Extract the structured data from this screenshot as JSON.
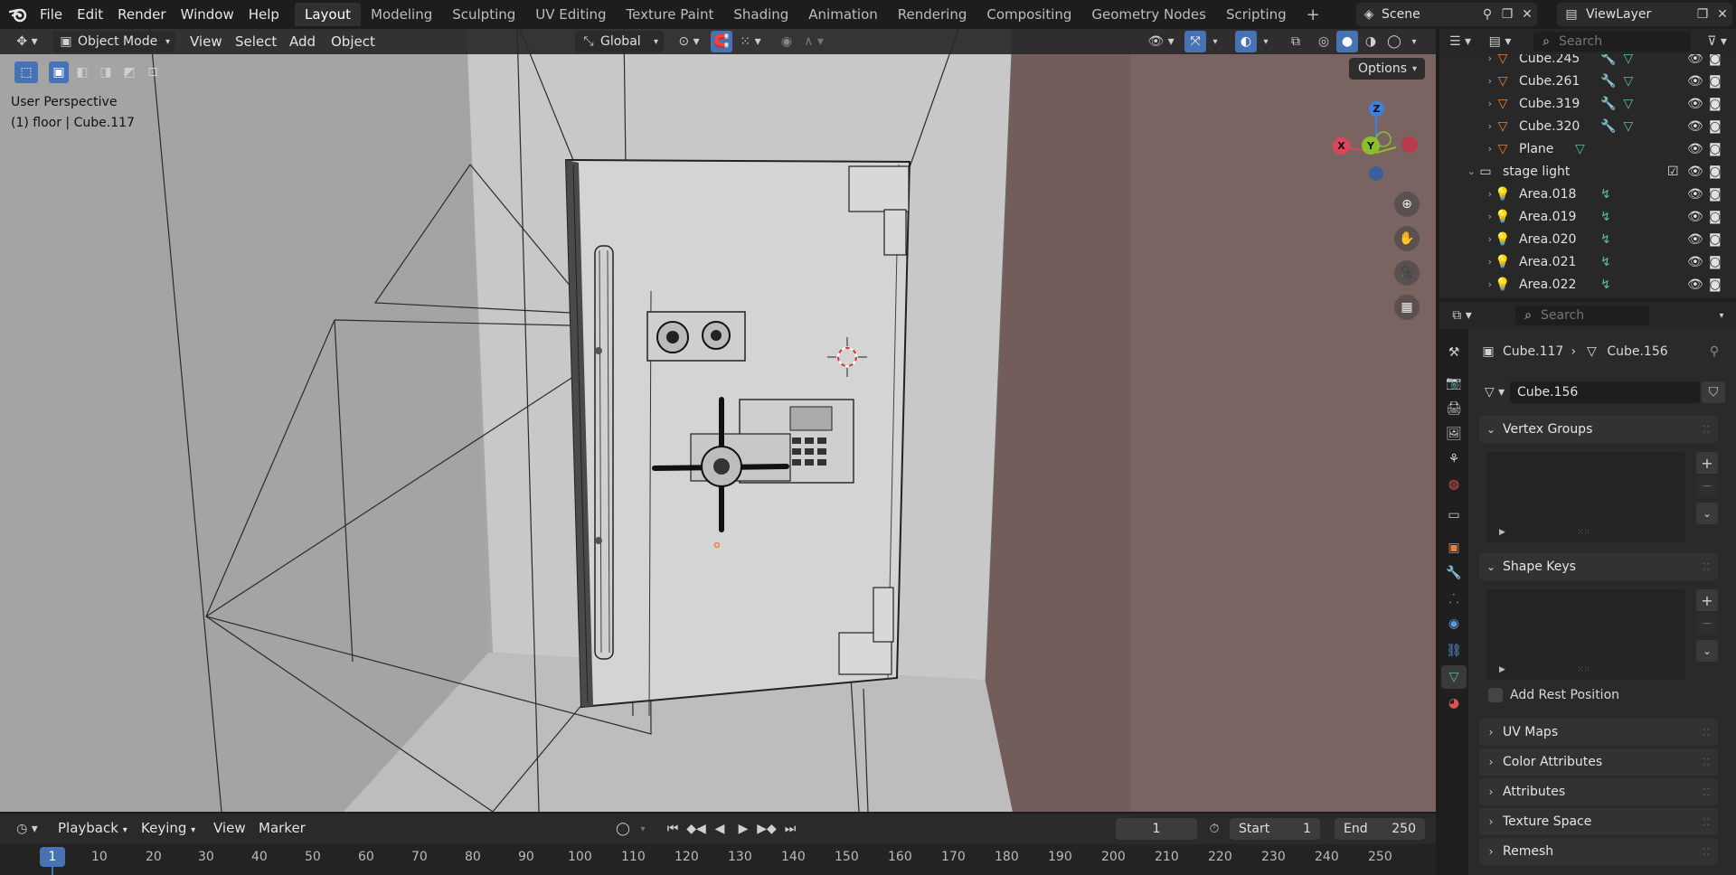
{
  "menu": {
    "file": "File",
    "edit": "Edit",
    "render": "Render",
    "window": "Window",
    "help": "Help"
  },
  "workspaces": [
    "Layout",
    "Modeling",
    "Sculpting",
    "UV Editing",
    "Texture Paint",
    "Shading",
    "Animation",
    "Rendering",
    "Compositing",
    "Geometry Nodes",
    "Scripting"
  ],
  "scene": {
    "name": "Scene",
    "view_layer": "ViewLayer"
  },
  "viewport": {
    "mode": "Object Mode",
    "menus": {
      "view": "View",
      "select": "Select",
      "add": "Add",
      "object": "Object"
    },
    "orientation": "Global",
    "options": "Options",
    "perspective": "User Perspective",
    "context": "(1) floor | Cube.117",
    "gizmo": {
      "x": "X",
      "y": "Y",
      "z": "Z"
    }
  },
  "outliner": {
    "search_placeholder": "Search",
    "rows": [
      "Cube.245",
      "Cube.261",
      "Cube.319",
      "Cube.320",
      "Plane"
    ],
    "collection": "stage light",
    "lights": [
      "Area.018",
      "Area.019",
      "Area.020",
      "Area.021",
      "Area.022"
    ]
  },
  "properties": {
    "search_placeholder": "Search",
    "breadcrumb_object": "Cube.117",
    "breadcrumb_data": "Cube.156",
    "mesh_name": "Cube.156",
    "panels": {
      "vertex_groups": "Vertex Groups",
      "shape_keys": "Shape Keys",
      "add_rest_position": "Add Rest Position",
      "uv_maps": "UV Maps",
      "color_attributes": "Color Attributes",
      "attributes": "Attributes",
      "texture_space": "Texture Space",
      "remesh": "Remesh"
    }
  },
  "timeline": {
    "playback": "Playback",
    "keying": "Keying",
    "view": "View",
    "marker": "Marker",
    "current_frame": "1",
    "start_label": "Start",
    "start": "1",
    "end_label": "End",
    "end": "250",
    "ruler": [
      "1",
      "10",
      "20",
      "30",
      "40",
      "50",
      "60",
      "70",
      "80",
      "90",
      "100",
      "110",
      "120",
      "130",
      "140",
      "150",
      "160",
      "170",
      "180",
      "190",
      "200",
      "210",
      "220",
      "230",
      "240",
      "250"
    ]
  },
  "colors": {
    "accent": "#4772b3",
    "mesh_orange": "#e8803a",
    "data_green": "#5bc28b",
    "axis_x": "#e0445a",
    "axis_y": "#8bc02a",
    "axis_z": "#3b82e0"
  }
}
